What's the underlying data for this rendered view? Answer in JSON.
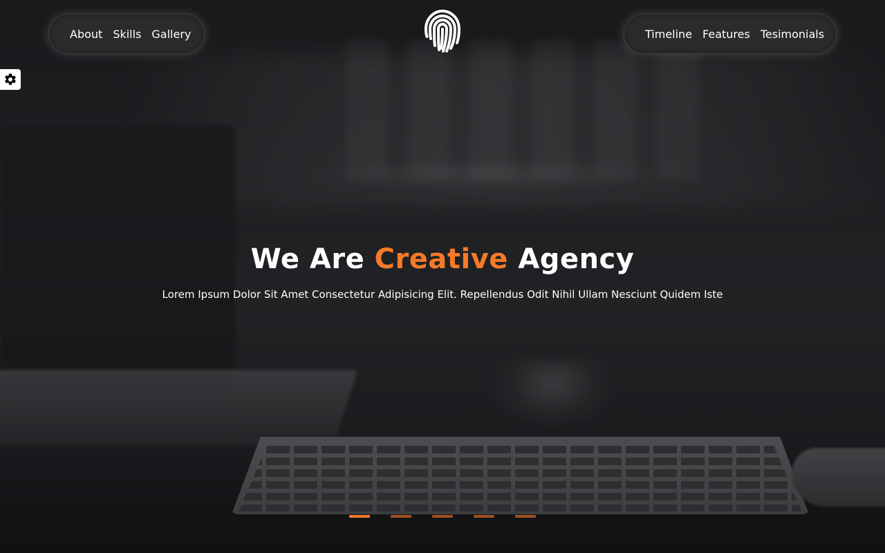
{
  "nav_left": {
    "items": [
      {
        "label": "About"
      },
      {
        "label": "Skills"
      },
      {
        "label": "Gallery"
      }
    ]
  },
  "nav_right": {
    "items": [
      {
        "label": "Timeline"
      },
      {
        "label": "Features"
      },
      {
        "label": "Tesimonials"
      }
    ]
  },
  "logo": {
    "icon": "fingerprint-icon"
  },
  "settings": {
    "icon": "gear-icon"
  },
  "hero": {
    "headline_before": "We Are ",
    "headline_accent": "Creative",
    "headline_after": " Agency",
    "subtitle": "Lorem Ipsum Dolor Sit Amet Consectetur Adipisicing Elit. Repellendus Odit Nihil Ullam Nesciunt Quidem Iste"
  },
  "slider": {
    "count": 5,
    "active_index": 0
  },
  "colors": {
    "accent": "#f47a29",
    "accent_dim": "#a0501f",
    "text": "#ffffff",
    "pill_bg": "#2a2b2d"
  }
}
